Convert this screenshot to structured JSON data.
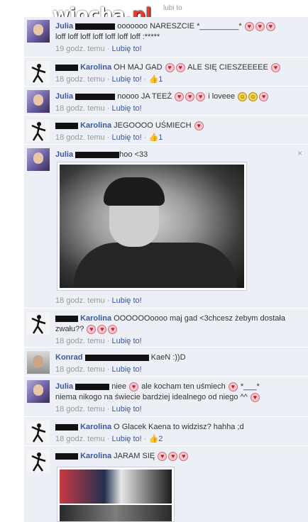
{
  "watermark": {
    "brand": "wiocha",
    "tld": ".pl"
  },
  "header_fragment": "lubi to",
  "comments": [
    {
      "name": "Julia",
      "text_before": "ooooooo NARESZCIE *_________*",
      "text_line2": "loff loff loff loff loff loff loff :*****",
      "time": "19 godz. temu",
      "like": "Lubię to!",
      "likes": ""
    },
    {
      "name": "Karolina",
      "text": "OH MAJ GAD",
      "text_after": "ALE SIĘ CIESZEEEEE",
      "time": "18 godz. temu",
      "like": "Lubię to!",
      "likes": "1"
    },
    {
      "name": "Julia",
      "text": "noooo JA TEEŻ",
      "text_after": "i loveee",
      "time": "18 godz. temu",
      "like": "Lubię to!",
      "likes": ""
    },
    {
      "name": "Karolina",
      "text": "JEGOOOO UŚMIECH",
      "time": "18 godz. temu",
      "like": "Lubię to!",
      "likes": "1"
    },
    {
      "name": "Julia",
      "text": "hoo <33",
      "time": "18 godz. temu",
      "like": "Lubię to!",
      "likes": ""
    },
    {
      "name": "Karolina",
      "text": "OOOOOOoooo maj gad <3chcesz żebym dostała",
      "text_line2": "zwału??",
      "time": "18 godz. temu",
      "like": "Lubię to!",
      "likes": ""
    },
    {
      "name": "Konrad",
      "text": "KaeN :))D",
      "time": "18 godz. temu",
      "like": "Lubię to!",
      "likes": ""
    },
    {
      "name": "Julia",
      "text": "niee",
      "text_after": "ale kocham ten uśmiech",
      "text_tail": "*___*",
      "text_line2": "niema nikogo na świecie bardziej idealnego od niego ^^",
      "time": "18 godz. temu",
      "like": "Lubię to!",
      "likes": ""
    },
    {
      "name": "Karolina",
      "text": "O Glacek Kaena to widzisz? hahha ;d",
      "time": "18 godz. temu",
      "like": "Lubię to!",
      "likes": "2"
    },
    {
      "name": "Karolina",
      "text": "JARAM SIĘ",
      "time": "",
      "like": "",
      "likes": ""
    }
  ],
  "separator": " · ",
  "thumb_glyph": "👍",
  "close_glyph": "×",
  "heart_glyph": "♥",
  "smile_glyph": "☺",
  "colors": {
    "link": "#3b5998",
    "panel": "#eceff5",
    "meta": "#999999"
  }
}
